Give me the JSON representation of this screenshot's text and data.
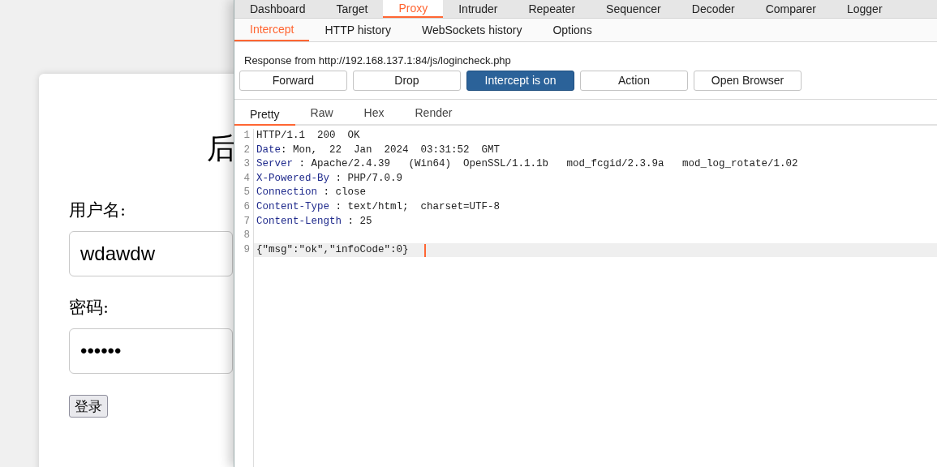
{
  "login_page": {
    "title": "后",
    "username_label": "用户名:",
    "username_value": "wdawdw",
    "password_label": "密码:",
    "password_value": "••••••",
    "submit": "登录"
  },
  "burp": {
    "tabs": [
      {
        "label": "Dashboard",
        "selected": false
      },
      {
        "label": "Target",
        "selected": false
      },
      {
        "label": "Proxy",
        "selected": true
      },
      {
        "label": "Intruder",
        "selected": false
      },
      {
        "label": "Repeater",
        "selected": false
      },
      {
        "label": "Sequencer",
        "selected": false
      },
      {
        "label": "Decoder",
        "selected": false
      },
      {
        "label": "Comparer",
        "selected": false
      },
      {
        "label": "Logger",
        "selected": false
      }
    ],
    "subtabs": [
      {
        "label": "Intercept",
        "selected": true
      },
      {
        "label": "HTTP history",
        "selected": false
      },
      {
        "label": "WebSockets history",
        "selected": false
      },
      {
        "label": "Options",
        "selected": false
      }
    ],
    "response_info": "Response from http://192.168.137.1:84/js/logincheck.php",
    "buttons": [
      {
        "label": "Forward",
        "on": false
      },
      {
        "label": "Drop",
        "on": false
      },
      {
        "label": "Intercept is on",
        "on": true
      },
      {
        "label": "Action",
        "on": false
      },
      {
        "label": "Open Browser",
        "on": false
      }
    ],
    "view_tabs": [
      {
        "label": "Pretty",
        "selected": true
      },
      {
        "label": "Raw",
        "selected": false
      },
      {
        "label": "Hex",
        "selected": false
      },
      {
        "label": "Render",
        "selected": false
      }
    ],
    "editor_lines": [
      {
        "number": "1",
        "kind": "status",
        "text": "HTTP/1.1  200  OK",
        "current": false
      },
      {
        "number": "2",
        "kind": "header",
        "name": "Date",
        "separator": ":",
        "value": " Mon,  22  Jan  2024  03:31:52  GMT",
        "current": false
      },
      {
        "number": "3",
        "kind": "header",
        "name": "Server",
        "separator": " :",
        "value": " Apache/2.4.39   (Win64)  OpenSSL/1.1.1b   mod_fcgid/2.3.9a   mod_log_rotate/1.02",
        "current": false
      },
      {
        "number": "4",
        "kind": "header",
        "name": "X-Powered-By",
        "separator": " :",
        "value": " PHP/7.0.9",
        "current": false
      },
      {
        "number": "5",
        "kind": "header",
        "name": "Connection",
        "separator": " :",
        "value": " close",
        "current": false
      },
      {
        "number": "6",
        "kind": "header",
        "name": "Content-Type",
        "separator": " :",
        "value": " text/html;  charset=UTF-8",
        "current": false
      },
      {
        "number": "7",
        "kind": "header",
        "name": "Content-Length",
        "separator": " :",
        "value": " 25",
        "current": false
      },
      {
        "number": "8",
        "kind": "blank",
        "current": false
      },
      {
        "number": "9",
        "kind": "body",
        "text": "{\"msg\":\"ok\",\"infoCode\":0}",
        "current": true
      }
    ]
  }
}
